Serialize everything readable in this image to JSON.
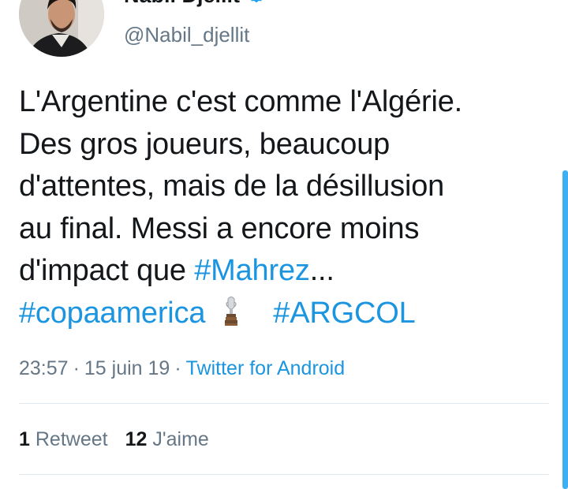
{
  "author": {
    "name": "Nabil Djellit",
    "handle": "@Nabil_djellit",
    "verified_icon": "verified-badge-icon"
  },
  "tweet": {
    "line1": "L'Argentine c'est comme l'Algérie.",
    "line2": "Des gros joueurs, beaucoup",
    "line3": "d'attentes, mais de la désillusion",
    "line4": "au final. Messi a encore moins",
    "line5_text": "d'impact que ",
    "hashtag_mahrez": "#Mahrez",
    "ellipsis": "...",
    "hashtag_copa": "#copaamerica",
    "trophy_emoji": "trophy-icon",
    "hashtag_argcol": "#ARGCOL"
  },
  "meta": {
    "time": "23:57",
    "date": "15 juin 19",
    "dot": "·",
    "source": "Twitter for Android"
  },
  "stats": {
    "retweets_count": "1",
    "retweets_label": "Retweet",
    "likes_count": "12",
    "likes_label": "J'aime"
  },
  "colors": {
    "link": "#1b95e0",
    "text": "#14171a",
    "secondary": "#657786",
    "verified": "#1da1f2"
  }
}
